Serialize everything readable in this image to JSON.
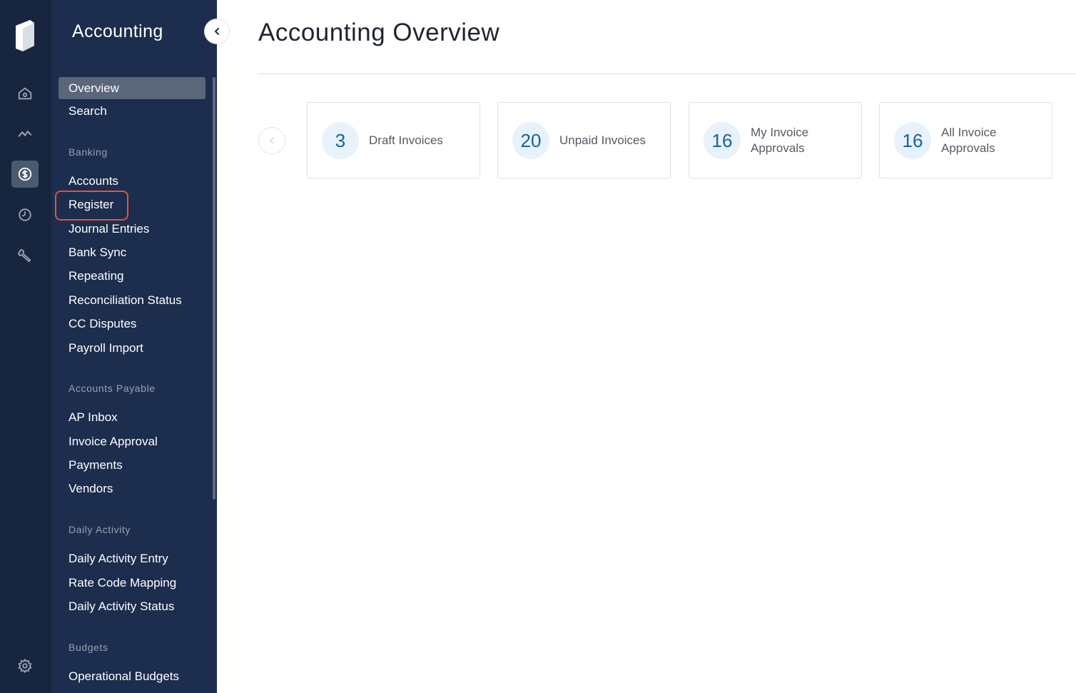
{
  "rail": {
    "items": [
      {
        "name": "home-icon"
      },
      {
        "name": "activity-icon"
      },
      {
        "name": "dollar-icon"
      },
      {
        "name": "clock-icon"
      },
      {
        "name": "wrench-icon"
      },
      {
        "name": "settings-icon"
      }
    ],
    "active_color": "#4c5a70"
  },
  "nav": {
    "title": "Accounting",
    "items": {
      "overview": "Overview",
      "search": "Search",
      "banking_header": "Banking",
      "accounts": "Accounts",
      "register": "Register",
      "journal_entries": "Journal Entries",
      "bank_sync": "Bank Sync",
      "repeating": "Repeating",
      "reconciliation_status": "Reconciliation Status",
      "cc_disputes": "CC Disputes",
      "payroll_import": "Payroll Import",
      "ap_header": "Accounts Payable",
      "ap_inbox": "AP Inbox",
      "invoice_approval": "Invoice Approval",
      "payments": "Payments",
      "vendors": "Vendors",
      "daily_header": "Daily Activity",
      "daily_activity_entry": "Daily Activity Entry",
      "rate_code_mapping": "Rate Code Mapping",
      "daily_activity_status": "Daily Activity Status",
      "budgets_header": "Budgets",
      "operational_budgets": "Operational Budgets"
    }
  },
  "main": {
    "title": "Accounting Overview",
    "cards": [
      {
        "count": "3",
        "line1": "Draft Invoices",
        "line2": ""
      },
      {
        "count": "20",
        "line1": "Unpaid Invoices",
        "line2": ""
      },
      {
        "count": "16",
        "line1": "My Invoice",
        "line2": "Approvals"
      },
      {
        "count": "16",
        "line1": "All Invoice",
        "line2": "Approvals"
      }
    ]
  },
  "colors": {
    "rail_bg": "#17253f",
    "nav_bg": "#1c2d4d",
    "highlight": "#e0533d",
    "badge_bg": "#e7f2fc",
    "badge_text": "#1f5f9c"
  }
}
